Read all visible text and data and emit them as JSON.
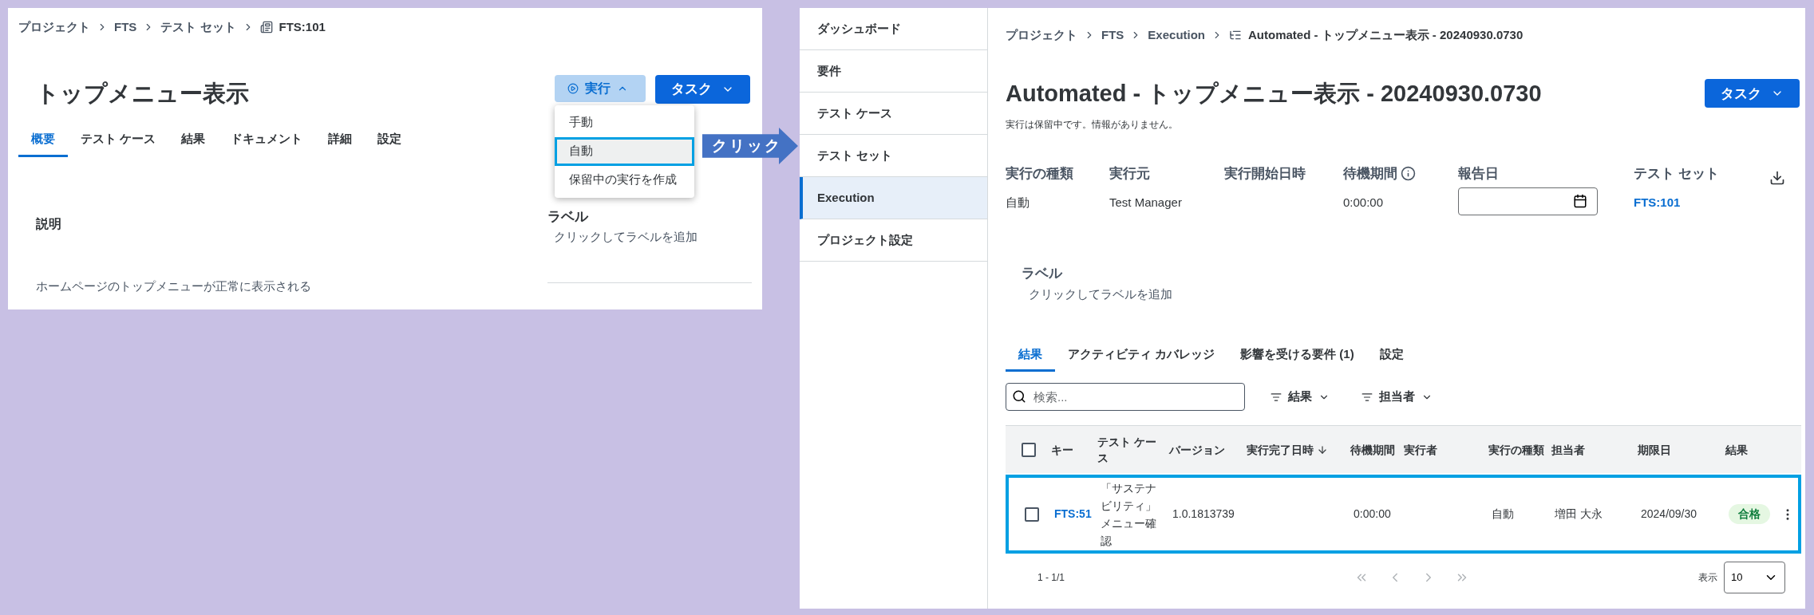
{
  "left_screen": {
    "breadcrumb": [
      "プロジェクト",
      "FTS",
      "テスト セット"
    ],
    "breadcrumb_current": "FTS:101",
    "title": "トップメニュー表示",
    "run_button": {
      "label": "実行",
      "expanded": true
    },
    "task_button": "タスク",
    "run_menu": [
      {
        "label": "手動",
        "selected": false
      },
      {
        "label": "自動",
        "selected": true
      },
      {
        "label": "保留中の実行を作成",
        "selected": false
      }
    ],
    "tabs": [
      {
        "label": "概要",
        "selected": true
      },
      {
        "label": "テスト ケース",
        "selected": false
      },
      {
        "label": "結果",
        "selected": false
      },
      {
        "label": "ドキュメント",
        "selected": false
      },
      {
        "label": "詳細",
        "selected": false
      },
      {
        "label": "設定",
        "selected": false
      }
    ],
    "description_heading": "説明",
    "description_text": "ホームページのトップメニューが正常に表示される",
    "label_heading": "ラベル",
    "label_hint": "クリックしてラベルを追加"
  },
  "annotation": {
    "label": "クリック"
  },
  "right_screen": {
    "sidebar": [
      {
        "label": "ダッシュボード",
        "selected": false
      },
      {
        "label": "要件",
        "selected": false
      },
      {
        "label": "テスト ケース",
        "selected": false
      },
      {
        "label": "テスト セット",
        "selected": false
      },
      {
        "label": "Execution",
        "selected": true
      },
      {
        "label": "プロジェクト設定",
        "selected": false
      }
    ],
    "breadcrumb": [
      "プロジェクト",
      "FTS",
      "Execution"
    ],
    "breadcrumb_current": "Automated - トップメニュー表示 - 20240930.0730",
    "title": "Automated - トップメニュー表示 - 20240930.0730",
    "task_button": "タスク",
    "status_message": "実行は保留中です。情報がありません。",
    "fields": [
      {
        "kind": "text",
        "label": "実行の種類",
        "value": "自動"
      },
      {
        "kind": "text",
        "label": "実行元",
        "value": "Test Manager"
      },
      {
        "kind": "text",
        "label": "実行開始日時"
      },
      {
        "kind": "info",
        "label": "待機期間",
        "value": "0:00:00"
      },
      {
        "kind": "date",
        "label": "報告日"
      },
      {
        "kind": "link",
        "label": "テスト セット",
        "value": "FTS:101"
      }
    ],
    "label_heading": "ラベル",
    "label_hint": "クリックしてラベルを追加",
    "tabs": [
      {
        "label": "結果",
        "selected": true
      },
      {
        "label": "アクティビティ カバレッジ",
        "selected": false
      },
      {
        "label": "影響を受ける要件 (1)",
        "selected": false
      },
      {
        "label": "設定",
        "selected": false
      }
    ],
    "search": {
      "placeholder": "検索..."
    },
    "filters": [
      "結果",
      "担当者"
    ],
    "table": {
      "header_checked": false,
      "columns": [
        {
          "label": "キー",
          "sorted": false
        },
        {
          "label": "テスト ケース",
          "sorted": false
        },
        {
          "label": "バージョン",
          "sorted": false
        },
        {
          "label": "実行完了日時",
          "sorted": true
        },
        {
          "label": "待機期間",
          "sorted": false
        },
        {
          "label": "実行者",
          "sorted": false
        },
        {
          "label": "実行の種類",
          "sorted": false
        },
        {
          "label": "担当者",
          "sorted": false
        },
        {
          "label": "期限日",
          "sorted": false
        },
        {
          "label": "結果",
          "sorted": false
        }
      ],
      "rows": [
        {
          "checked": false,
          "highlighted": true,
          "key": "FTS:51",
          "test_case": "「サステナビリティ」メニュー確認",
          "version": "1.0.1813739",
          "wait": "0:00:00",
          "type": "自動",
          "assignee": "増田 大永",
          "due": "2024/09/30",
          "result": {
            "kind": "pass",
            "label": "合格"
          }
        }
      ]
    },
    "pagination": {
      "range": "1 - 1/1",
      "page_size_label": "表示",
      "page_size": "10"
    }
  }
}
